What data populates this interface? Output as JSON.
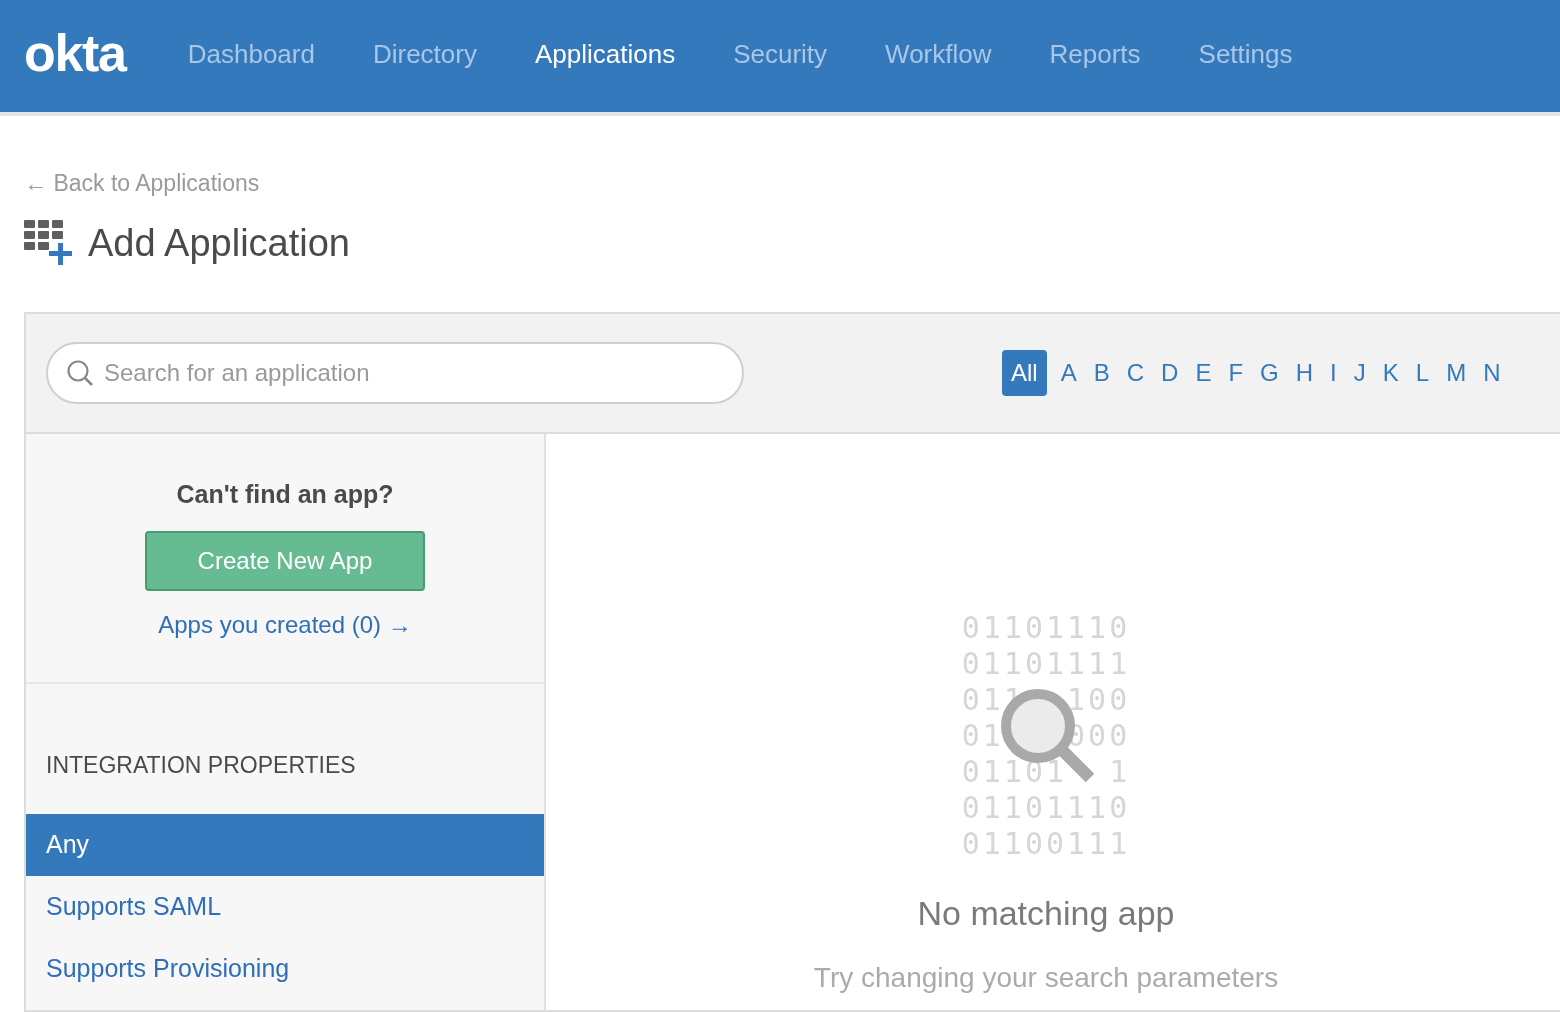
{
  "logo": "okta",
  "nav": [
    {
      "label": "Dashboard",
      "selected": false
    },
    {
      "label": "Directory",
      "selected": false
    },
    {
      "label": "Applications",
      "selected": true
    },
    {
      "label": "Security",
      "selected": false
    },
    {
      "label": "Workflow",
      "selected": false
    },
    {
      "label": "Reports",
      "selected": false
    },
    {
      "label": "Settings",
      "selected": false
    }
  ],
  "back_link": {
    "arrow": "←",
    "label": "Back to Applications"
  },
  "page_title": "Add Application",
  "search": {
    "placeholder": "Search for an application"
  },
  "letters": [
    {
      "label": "All",
      "selected": true
    },
    {
      "label": "A",
      "selected": false
    },
    {
      "label": "B",
      "selected": false
    },
    {
      "label": "C",
      "selected": false
    },
    {
      "label": "D",
      "selected": false
    },
    {
      "label": "E",
      "selected": false
    },
    {
      "label": "F",
      "selected": false
    },
    {
      "label": "G",
      "selected": false
    },
    {
      "label": "H",
      "selected": false
    },
    {
      "label": "I",
      "selected": false
    },
    {
      "label": "J",
      "selected": false
    },
    {
      "label": "K",
      "selected": false
    },
    {
      "label": "L",
      "selected": false
    },
    {
      "label": "M",
      "selected": false
    },
    {
      "label": "N",
      "selected": false
    }
  ],
  "sidebar": {
    "prompt": "Can't find an app?",
    "create_button": "Create New App",
    "created_link": {
      "label": "Apps you created (0)",
      "arrow": "→"
    },
    "section_title": "INTEGRATION PROPERTIES",
    "filters": [
      {
        "label": "Any",
        "selected": true
      },
      {
        "label": "Supports SAML",
        "selected": false
      },
      {
        "label": "Supports Provisioning",
        "selected": false
      }
    ]
  },
  "empty_state": {
    "binary": [
      "01101110",
      "01101111",
      "011  100",
      "01   000",
      "01101  1",
      "01101110",
      "01100111"
    ],
    "title": "No matching app",
    "message": "Try changing your search parameters"
  }
}
